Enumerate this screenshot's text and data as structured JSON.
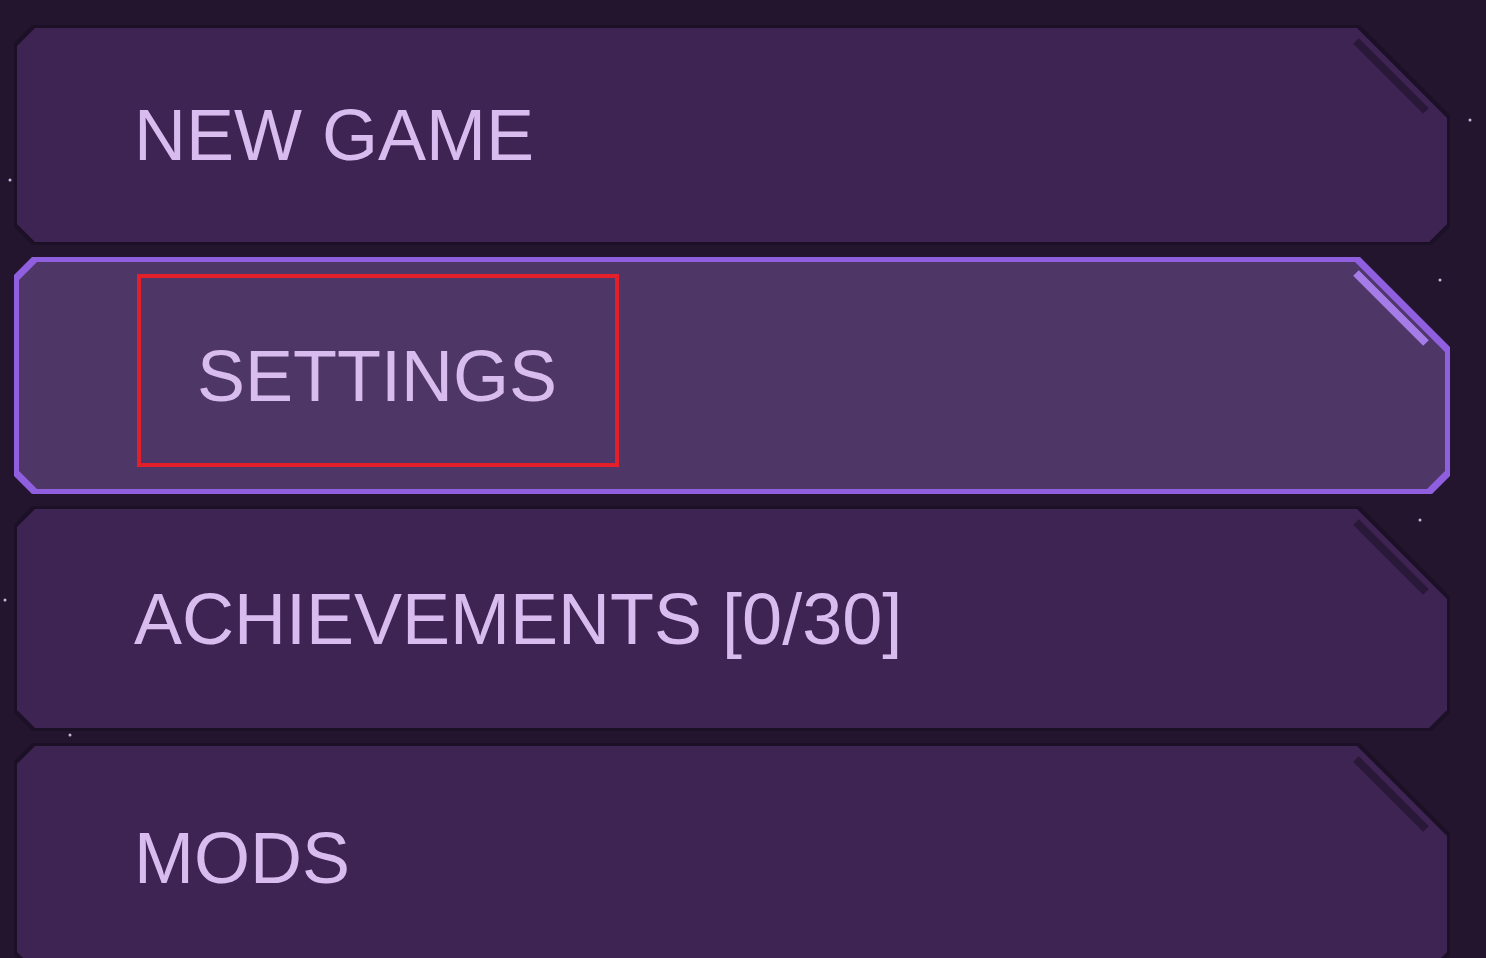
{
  "menu": {
    "items": [
      {
        "label": "NEW GAME",
        "selected": false,
        "highlighted": false
      },
      {
        "label": "SETTINGS",
        "selected": true,
        "highlighted": true
      },
      {
        "label": "ACHIEVEMENTS [0/30]",
        "selected": false,
        "highlighted": false
      },
      {
        "label": "MODS",
        "selected": false,
        "highlighted": false
      }
    ]
  }
}
